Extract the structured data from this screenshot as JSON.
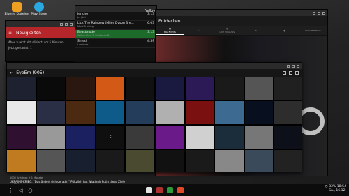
{
  "desktop": {
    "icons": [
      {
        "label": "Eigene Dateien",
        "color": "#f0a020"
      },
      {
        "label": "Play Store",
        "color": "#2aa9e0"
      }
    ]
  },
  "news_window": {
    "title": "Neuigkeiten",
    "status": "Abos zuletzt aktualisiert: vor 5 Minuten",
    "status2": "Jetzt gestartet: 1"
  },
  "music_window": {
    "header": "Yellow",
    "tracks": [
      {
        "title": "Jericho",
        "artist": "Jcl Jdet",
        "time": "3:13",
        "selected": false
      },
      {
        "title": "Lick The Rainbow (Miles Dyson Bre...",
        "artist": "Mind Fucking",
        "time": "6:03",
        "selected": false
      },
      {
        "title": "Beastmode",
        "artist": "Yellow Claw & Stoltencluff",
        "time": "3:13",
        "selected": true
      },
      {
        "title": "Shred",
        "artist": "Lambuss",
        "time": "4:59",
        "selected": false
      }
    ]
  },
  "entdecken_window": {
    "title": "Entdecken",
    "tabs": [
      "MAI FOTOS",
      "",
      "LIVE EXKLUSIV",
      "",
      "",
      "WOCHENENDE"
    ]
  },
  "eyeem_window": {
    "title": "EyeEm (905)",
    "tiles": [
      {
        "bg": "#1e2230",
        "label": ""
      },
      {
        "bg": "#0a0a0a",
        "label": ""
      },
      {
        "bg": "#2a1810",
        "label": ""
      },
      {
        "bg": "#d35a16",
        "label": ""
      },
      {
        "bg": "#111",
        "label": ""
      },
      {
        "bg": "#1a1a40",
        "label": ""
      },
      {
        "bg": "#2b1a55",
        "label": ""
      },
      {
        "bg": "#1a1a1a",
        "label": ""
      },
      {
        "bg": "#555",
        "label": ""
      },
      {
        "bg": "#202020",
        "label": ""
      },
      {
        "bg": "#e8e8e8",
        "label": ""
      },
      {
        "bg": "#2a2f45",
        "label": ""
      },
      {
        "bg": "#4c2a12",
        "label": ""
      },
      {
        "bg": "#0e5b8a",
        "label": ""
      },
      {
        "bg": "#233d5a",
        "label": ""
      },
      {
        "bg": "#b0b0b0",
        "label": ""
      },
      {
        "bg": "#7a1010",
        "label": ""
      },
      {
        "bg": "#3c6a90",
        "label": ""
      },
      {
        "bg": "#081020",
        "label": ""
      },
      {
        "bg": "#2d2d2d",
        "label": ""
      },
      {
        "bg": "#301030",
        "label": ""
      },
      {
        "bg": "#999",
        "label": ""
      },
      {
        "bg": "#1a2060",
        "label": ""
      },
      {
        "bg": "#0f0f0f",
        "label": "E"
      },
      {
        "bg": "#3a3a3a",
        "label": ""
      },
      {
        "bg": "#6b1a8a",
        "label": ""
      },
      {
        "bg": "#d0d0d0",
        "label": ""
      },
      {
        "bg": "#1b2d3b",
        "label": ""
      },
      {
        "bg": "#777",
        "label": ""
      },
      {
        "bg": "#0d1018",
        "label": ""
      },
      {
        "bg": "#c07a20",
        "label": ""
      },
      {
        "bg": "#555",
        "label": ""
      },
      {
        "bg": "#182030",
        "label": ""
      },
      {
        "bg": "#1a1a1a",
        "label": ""
      },
      {
        "bg": "#4a4a30",
        "label": ""
      },
      {
        "bg": "#111",
        "label": ""
      },
      {
        "bg": "#1a1a1a",
        "label": ""
      },
      {
        "bg": "#888",
        "label": ""
      },
      {
        "bg": "#3a4a5a",
        "label": ""
      },
      {
        "bg": "#222",
        "label": ""
      }
    ]
  },
  "footer_card": {
    "caption": "1000 Anhänge + 1 Monate",
    "headline": "UKRAINE-KRIEG: \"Das ändert sich gerade!\" Plötzlich hat Wladimir Putin diese Ziele",
    "more": "im Visier"
  },
  "taskbar": {
    "battery": "83%",
    "time": "18:54",
    "date": "Sa., 16.12."
  }
}
